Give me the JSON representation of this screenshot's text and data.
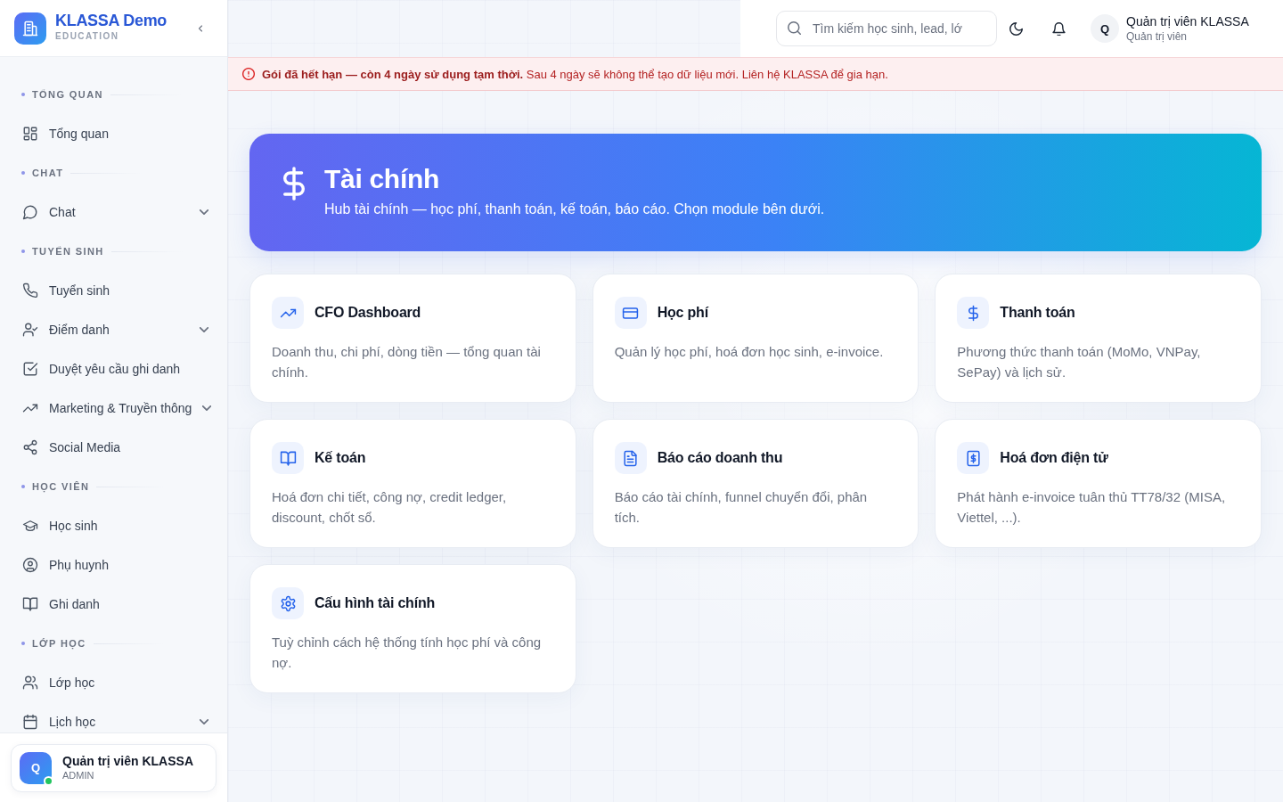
{
  "sidebar": {
    "brand": {
      "name": "KLASSA Demo",
      "subtitle": "EDUCATION"
    },
    "sections": [
      {
        "label": "TỔNG QUAN",
        "items": [
          {
            "label": "Tổng quan",
            "kind": "dashboard",
            "submenu": false
          }
        ]
      },
      {
        "label": "CHAT",
        "items": [
          {
            "label": "Chat",
            "kind": "chat",
            "submenu": true
          }
        ]
      },
      {
        "label": "TUYỂN SINH",
        "items": [
          {
            "label": "Tuyển sinh",
            "kind": "phone",
            "submenu": false
          },
          {
            "label": "Điểm danh",
            "kind": "attendance",
            "submenu": true
          },
          {
            "label": "Duyệt yêu cầu ghi danh",
            "kind": "approval",
            "submenu": false
          },
          {
            "label": "Marketing & Truyền thông",
            "kind": "trend",
            "submenu": true
          },
          {
            "label": "Social Media",
            "kind": "share",
            "submenu": false
          }
        ]
      },
      {
        "label": "HỌC VIÊN",
        "items": [
          {
            "label": "Học sinh",
            "kind": "student",
            "submenu": false
          },
          {
            "label": "Phụ huynh",
            "kind": "parent",
            "submenu": false
          },
          {
            "label": "Ghi danh",
            "kind": "book",
            "submenu": false
          }
        ]
      },
      {
        "label": "LỚP HỌC",
        "items": [
          {
            "label": "Lớp học",
            "kind": "class",
            "submenu": false
          },
          {
            "label": "Lịch học",
            "kind": "calendar",
            "submenu": true
          }
        ]
      }
    ],
    "user": {
      "avatar": "Q",
      "name": "Quản trị viên KLASSA",
      "role": "ADMIN",
      "online": true
    }
  },
  "topbar": {
    "search": {
      "placeholder": "Tìm kiếm học sinh, lead, lớ"
    },
    "user": {
      "avatar": "Q",
      "name": "Quản trị viên KLASSA",
      "role": "Quản trị viên"
    }
  },
  "alert": {
    "message": "**Gói đã hết hạn — còn 4 ngày sử dụng tạm thời.** Sau 4 ngày sẽ không thể tạo dữ liệu mới. Liên hệ KLASSA để gia hạn."
  },
  "hero": {
    "title": "Tài chính",
    "subtitle": "Hub tài chính — học phí, thanh toán, kế toán, báo cáo. Chọn module bên dưới."
  },
  "modules": [
    {
      "title": "CFO Dashboard",
      "description": "Doanh thu, chi phí, dòng tiền — tổng quan tài chính.",
      "kind": "trend"
    },
    {
      "title": "Học phí",
      "description": "Quản lý học phí, hoá đơn học sinh, e-invoice.",
      "kind": "card"
    },
    {
      "title": "Thanh toán",
      "description": "Phương thức thanh toán (MoMo, VNPay, SePay) và lịch sử.",
      "kind": "dollar"
    },
    {
      "title": "Kế toán",
      "description": "Hoá đơn chi tiết, công nợ, credit ledger, discount, chốt sổ.",
      "kind": "book"
    },
    {
      "title": "Báo cáo doanh thu",
      "description": "Báo cáo tài chính, funnel chuyển đổi, phân tích.",
      "kind": "report"
    },
    {
      "title": "Hoá đơn điện tử",
      "description": "Phát hành e-invoice tuân thủ TT78/32 (MISA, Viettel, ...).",
      "kind": "invoice"
    },
    {
      "title": "Cấu hình tài chính",
      "description": "Tuỳ chỉnh cách hệ thống tính học phí và công nợ.",
      "kind": "settings"
    }
  ]
}
